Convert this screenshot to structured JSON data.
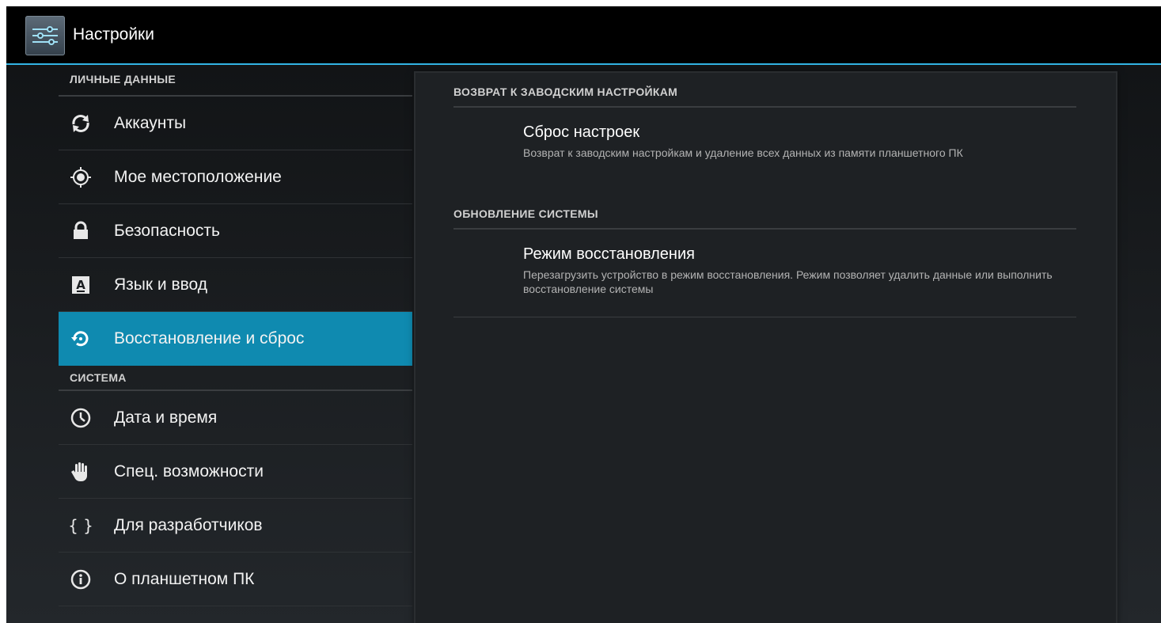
{
  "app": {
    "title": "Настройки",
    "icon": "settings-sliders-icon"
  },
  "colors": {
    "accent": "#33b5e5",
    "selected_bg": "#0f8ab0"
  },
  "sidebar": {
    "personal_header": "ЛИЧНЫЕ ДАННЫЕ",
    "personal_items": [
      {
        "label": "Аккаунты",
        "icon": "sync-icon"
      },
      {
        "label": "Мое местоположение",
        "icon": "location-icon"
      },
      {
        "label": "Безопасность",
        "icon": "lock-icon"
      },
      {
        "label": "Язык и ввод",
        "icon": "language-icon"
      },
      {
        "label": "Восстановление и сброс",
        "icon": "restore-icon",
        "selected": true
      }
    ],
    "system_header": "СИСТЕМА",
    "system_items": [
      {
        "label": "Дата и время",
        "icon": "clock-icon"
      },
      {
        "label": "Спец. возможности",
        "icon": "hand-icon"
      },
      {
        "label": "Для разработчиков",
        "icon": "braces-icon"
      },
      {
        "label": "О планшетном ПК",
        "icon": "info-icon"
      }
    ]
  },
  "detail": {
    "factory_header": "ВОЗВРАТ К ЗАВОДСКИМ НАСТРОЙКАМ",
    "factory_reset": {
      "title": "Сброс настроек",
      "summary": "Возврат к заводским настройкам и удаление всех данных из памяти планшетного ПК"
    },
    "update_header": "ОБНОВЛЕНИЕ СИСТЕМЫ",
    "recovery_mode": {
      "title": "Режим восстановления",
      "summary": "Перезагрузить устройство в режим восстановления. Режим позволяет удалить данные или выполнить восстановление системы"
    }
  }
}
